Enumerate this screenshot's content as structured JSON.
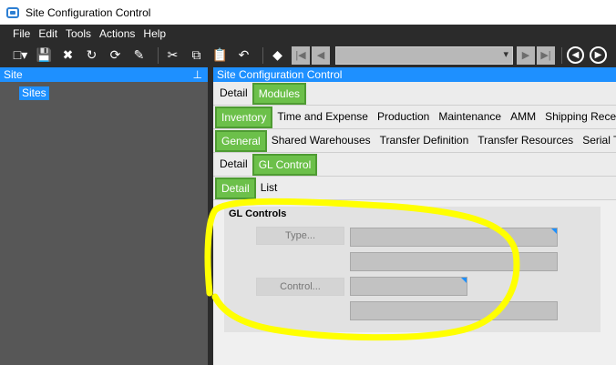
{
  "window": {
    "title": "Site Configuration Control"
  },
  "menu": [
    "File",
    "Edit",
    "Tools",
    "Actions",
    "Help"
  ],
  "toolbar": {
    "icons": [
      "new-icon",
      "save-icon",
      "delete-icon",
      "refresh-icon",
      "clear-icon",
      "cut-icon",
      "copy-icon",
      "paste-icon",
      "undo-icon",
      "search-icon"
    ],
    "nav": [
      "first-icon",
      "previous-icon",
      "next-icon",
      "last-icon"
    ],
    "combo_value": ""
  },
  "left_panel": {
    "title": "Site",
    "pin_glyph": "⊥",
    "tree": [
      "Sites"
    ]
  },
  "right_panel": {
    "title": "Site Configuration Control",
    "tab_rows": [
      {
        "tabs": [
          "Detail",
          "Modules"
        ],
        "active": 1
      },
      {
        "tabs": [
          "Inventory",
          "Time and Expense",
          "Production",
          "Maintenance",
          "AMM",
          "Shipping Recei"
        ],
        "active": 0
      },
      {
        "tabs": [
          "General",
          "Shared Warehouses",
          "Transfer Definition",
          "Transfer Resources",
          "Serial Tr"
        ],
        "active": 0
      },
      {
        "tabs": [
          "Detail",
          "GL Control"
        ],
        "active": 1
      },
      {
        "tabs": [
          "Detail",
          "List"
        ],
        "active": 0
      }
    ],
    "gl_controls": {
      "title": "GL Controls",
      "type_button": "Type...",
      "control_button": "Control..."
    }
  },
  "colors": {
    "accent": "#1e90ff",
    "tab_active": "#6cc04a",
    "annotation": "#ffff00"
  }
}
